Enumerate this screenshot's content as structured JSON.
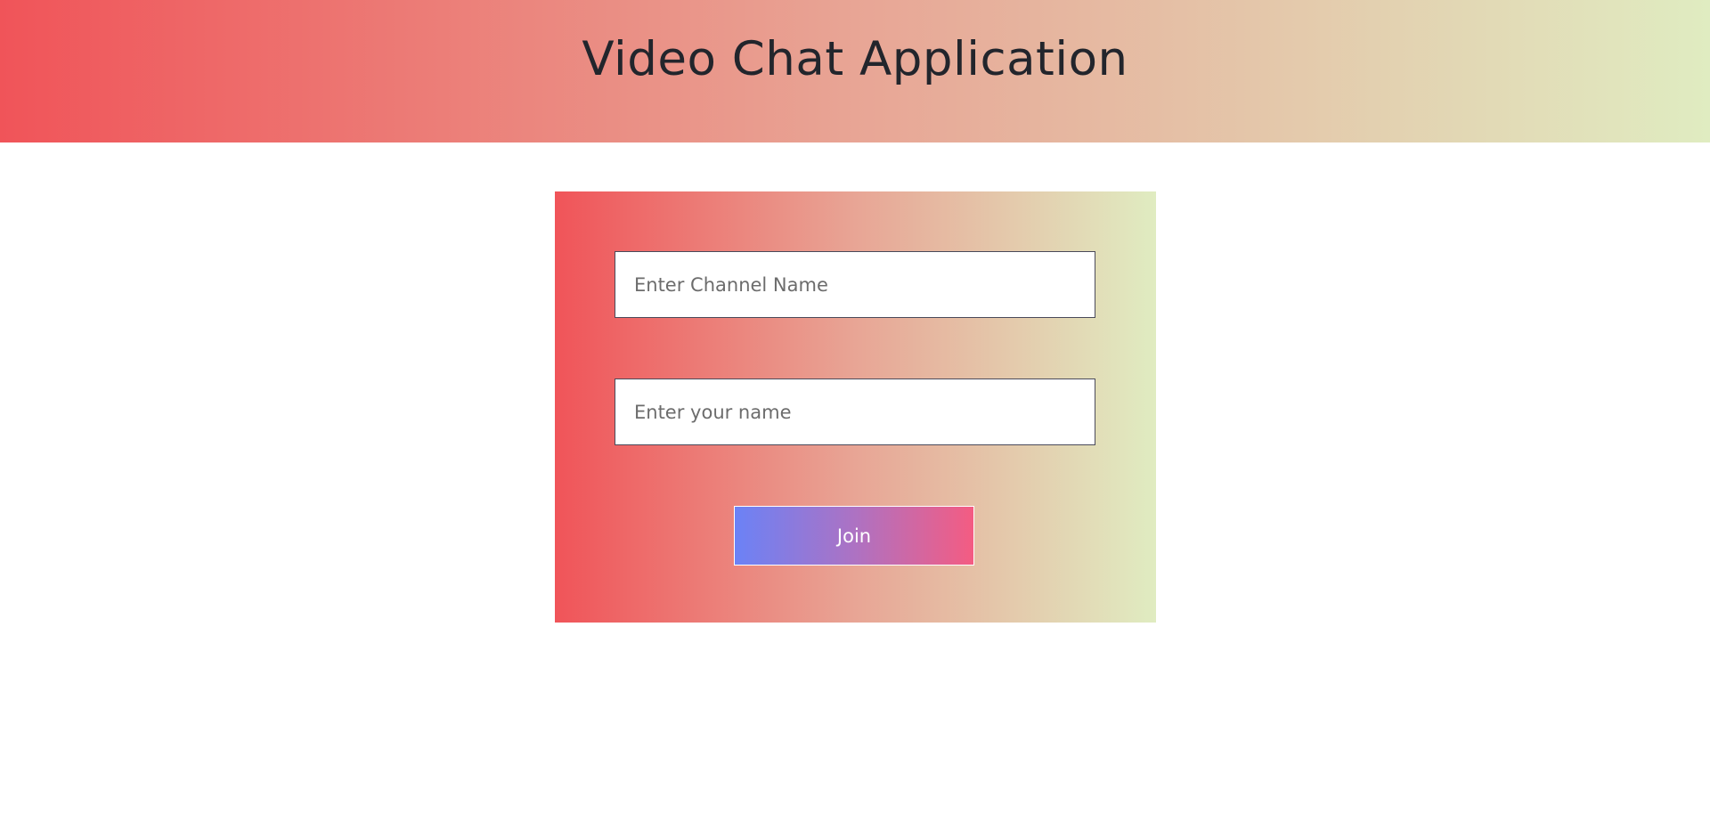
{
  "header": {
    "title": "Video Chat Application"
  },
  "form": {
    "channel_input": {
      "placeholder": "Enter Channel Name",
      "value": ""
    },
    "name_input": {
      "placeholder": "Enter your name",
      "value": ""
    },
    "join_label": "Join"
  },
  "colors": {
    "gradient_start": "#f05459",
    "gradient_mid": "#e8a595",
    "gradient_end": "#e0ecc1",
    "button_start": "#6b82f6",
    "button_end": "#f45c82",
    "title_text": "#22252c"
  }
}
